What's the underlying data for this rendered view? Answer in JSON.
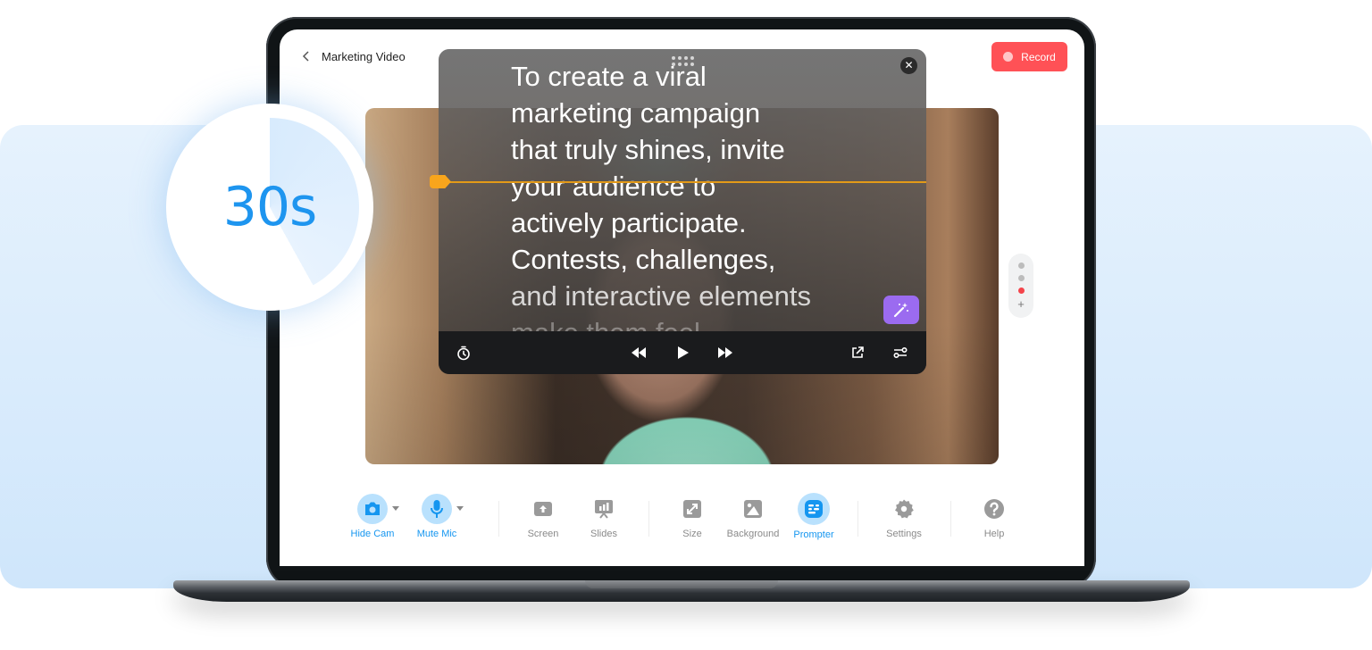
{
  "header": {
    "back_icon": "chevron-left-icon",
    "title": "Marketing Video",
    "record_label": "Record"
  },
  "countdown": {
    "label": "30s",
    "elapsed_fraction": 0.42,
    "accent": "#1e95ef"
  },
  "prompter": {
    "script_lines": [
      "To create a viral",
      "marketing campaign",
      "that truly shines, invite",
      "your audience to",
      "actively participate.",
      "Contests, challenges,",
      "and interactive elements",
      "make them feel"
    ],
    "close_icon": "close-icon",
    "drag_icon": "drag-handle-icon",
    "magic_icon": "magic-wand-icon",
    "marker_color": "#f8a51c",
    "controls": {
      "timer": "timer-icon",
      "rewind": "rewind-icon",
      "play": "play-icon",
      "forward": "fast-forward-icon",
      "popout": "external-link-icon",
      "settings": "sliders-icon"
    }
  },
  "scenes": {
    "count": 3,
    "active_index": 2,
    "add_label": "+"
  },
  "toolbar": {
    "items": [
      {
        "label": "Hide Cam",
        "icon": "camera-icon",
        "active": true
      },
      {
        "label": "Mute Mic",
        "icon": "microphone-icon",
        "active": true
      },
      {
        "label": "Screen",
        "icon": "screen-share-icon",
        "active": false
      },
      {
        "label": "Slides",
        "icon": "slides-icon",
        "active": false
      },
      {
        "label": "Size",
        "icon": "resize-icon",
        "active": false
      },
      {
        "label": "Background",
        "icon": "image-icon",
        "active": false
      },
      {
        "label": "Prompter",
        "icon": "prompter-icon",
        "active": true
      },
      {
        "label": "Settings",
        "icon": "gear-icon",
        "active": false
      },
      {
        "label": "Help",
        "icon": "help-icon",
        "active": false
      }
    ]
  },
  "colors": {
    "accent": "#1596f0",
    "record": "#ff5156",
    "magic": "#9b6bf0"
  }
}
